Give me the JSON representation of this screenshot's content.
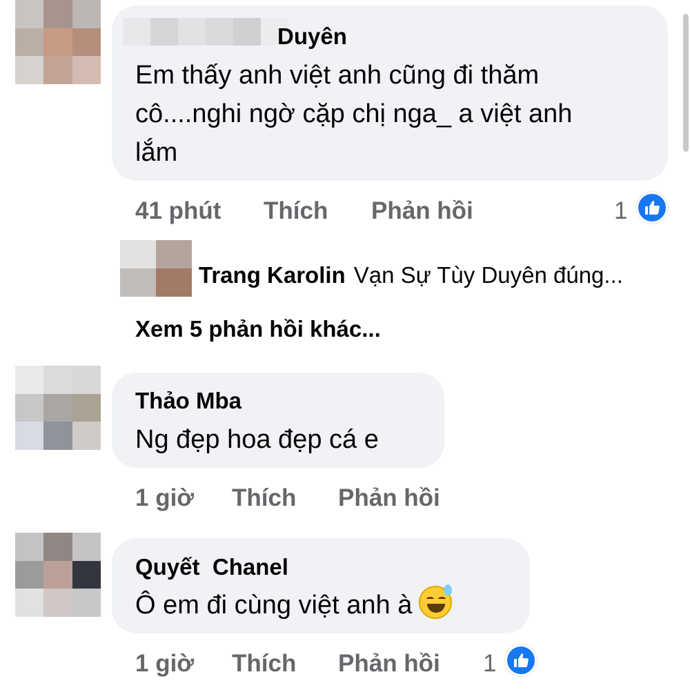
{
  "comments": [
    {
      "author": "Duyên",
      "text_lines": [
        "Em thấy anh việt anh cũng đi thăm",
        "cô....nghi ngờ cặp chị nga_ a việt anh",
        "lắm"
      ],
      "time": "41 phút",
      "like_label": "Thích",
      "reply_label": "Phản hồi",
      "reaction_count": "1",
      "reaction_icon": "like-icon"
    },
    {
      "author": "Thảo Mba",
      "text_lines": [
        "Ng đẹp hoa đẹp cá e"
      ],
      "time": "1 giờ",
      "like_label": "Thích",
      "reply_label": "Phản hồi"
    },
    {
      "author": "Quyết  Chanel",
      "text_lines": [
        "Ô em đi cùng việt anh à"
      ],
      "emoji": "grinning-sweat-emoji",
      "time": "1 giờ",
      "like_label": "Thích",
      "reply_label": "Phản hồi",
      "reaction_count": "1",
      "reaction_icon": "like-icon"
    }
  ],
  "reply_preview": {
    "author": "Trang Karolin",
    "snippet": "Vạn Sự Tùy Duyên đúng..."
  },
  "more_replies_label": "Xem 5 phản hồi khác...",
  "colors": {
    "bubble": "#f0f2f5",
    "secondary_text": "#65676b",
    "like_blue": "#1877f2"
  }
}
